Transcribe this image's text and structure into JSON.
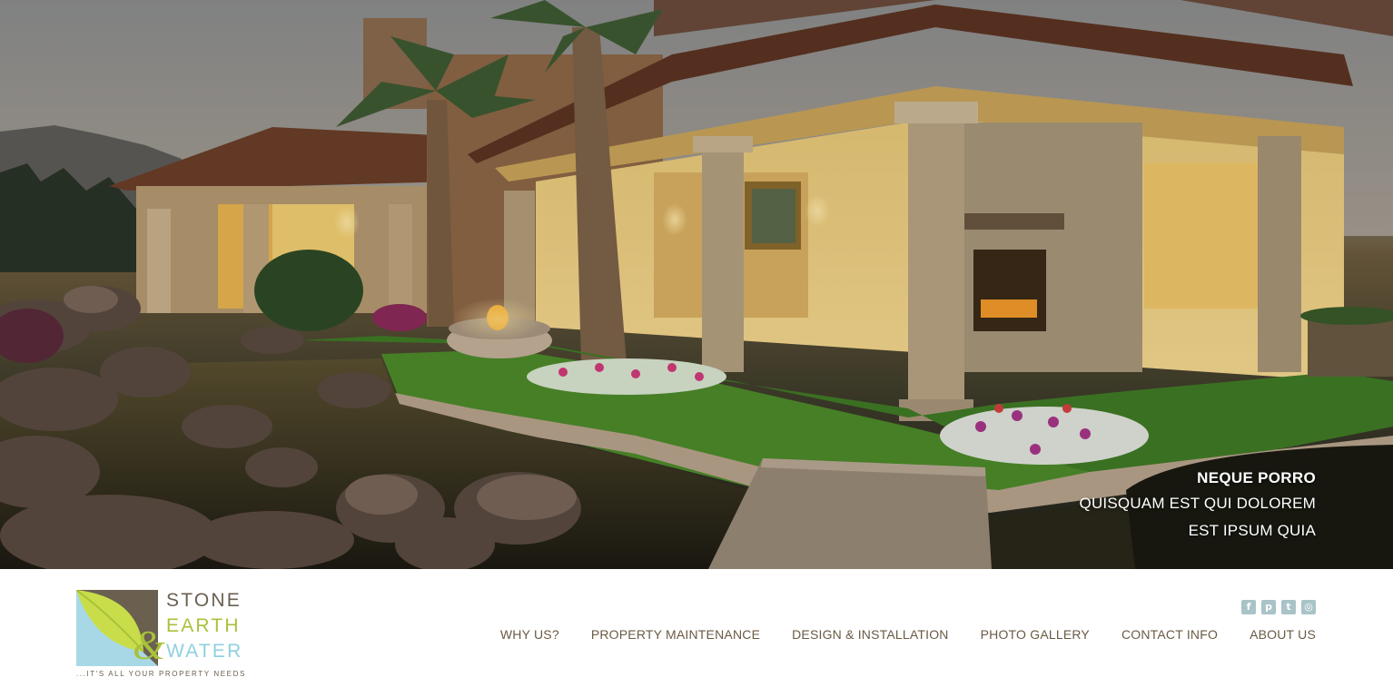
{
  "hero": {
    "caption": {
      "line1": "NEQUE PORRO",
      "line2": "QUISQUAM EST QUI DOLOREM",
      "line3": "EST IPSUM QUIA"
    }
  },
  "logo": {
    "word1": "STONE",
    "word2": "EARTH",
    "ampersand": "&",
    "word3": "WATER",
    "tagline": "...IT'S ALL YOUR PROPERTY NEEDS"
  },
  "social": [
    {
      "icon": "facebook-icon",
      "glyph": "f"
    },
    {
      "icon": "pinterest-icon",
      "glyph": "p"
    },
    {
      "icon": "twitter-icon",
      "glyph": "t"
    },
    {
      "icon": "instagram-icon",
      "glyph": "◎"
    }
  ],
  "nav": {
    "items": [
      {
        "label": "WHY US?"
      },
      {
        "label": "PROPERTY MAINTENANCE"
      },
      {
        "label": "DESIGN & INSTALLATION"
      },
      {
        "label": "PHOTO GALLERY"
      },
      {
        "label": "CONTACT INFO"
      },
      {
        "label": "ABOUT US"
      }
    ]
  },
  "colors": {
    "nav_text": "#6a5a44",
    "logo_brown": "#6b6050",
    "logo_green": "#a8c23a",
    "logo_blue": "#8ed0e0",
    "social_icon": "#a9c3c7"
  }
}
